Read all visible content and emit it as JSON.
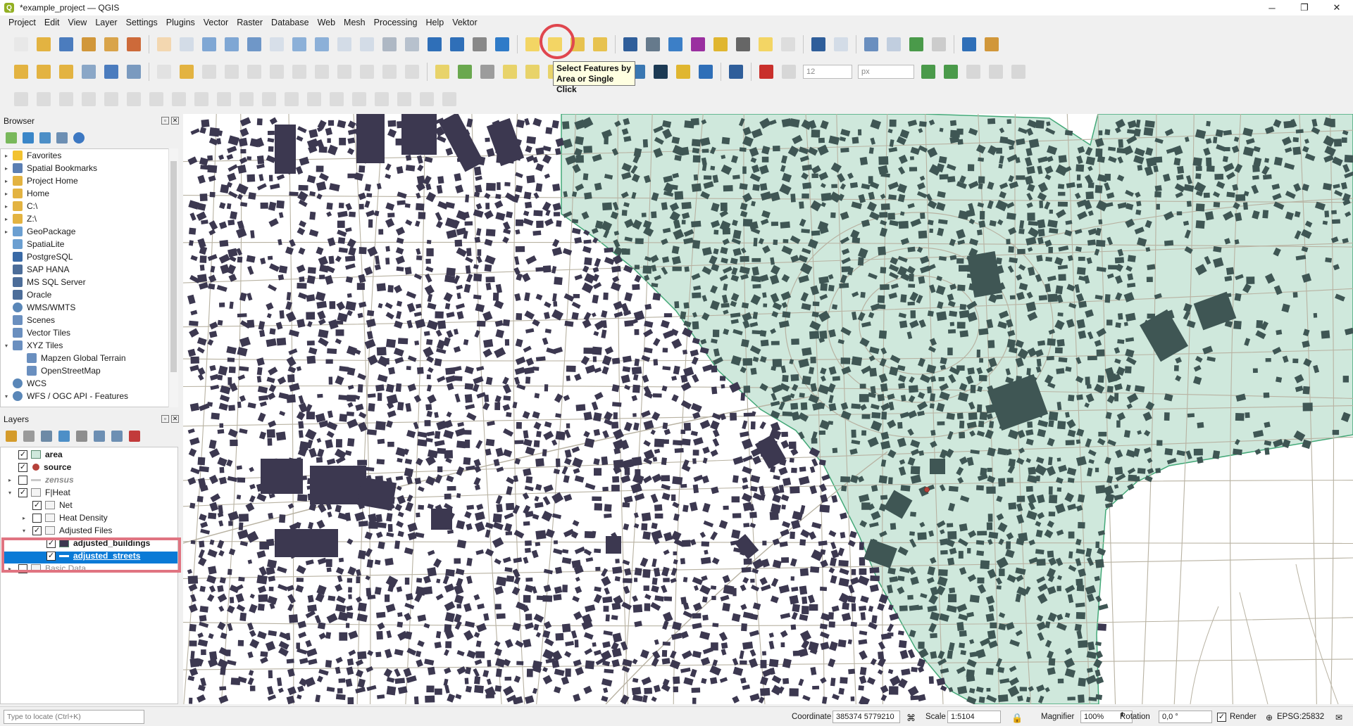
{
  "window": {
    "title": "*example_project — QGIS",
    "app_icon": "Q"
  },
  "menu": [
    "Project",
    "Edit",
    "View",
    "Layer",
    "Settings",
    "Plugins",
    "Vector",
    "Raster",
    "Database",
    "Web",
    "Mesh",
    "Processing",
    "Help",
    "Vektor"
  ],
  "toolbar": {
    "tooltip_line1": "Select Features by",
    "tooltip_line2": "Area or Single Click",
    "font_size_value": "12",
    "unit_value": "px",
    "abc_label": "abc"
  },
  "browser": {
    "title": "Browser",
    "items": [
      {
        "label": "Favorites",
        "icon": "star-icon",
        "arrow": "▸"
      },
      {
        "label": "Spatial Bookmarks",
        "icon": "bookmark-icon",
        "arrow": "▸"
      },
      {
        "label": "Project Home",
        "icon": "folder-icon",
        "arrow": "▸"
      },
      {
        "label": "Home",
        "icon": "folder-icon",
        "arrow": "▸"
      },
      {
        "label": "C:\\",
        "icon": "folder-icon",
        "arrow": "▸"
      },
      {
        "label": "Z:\\",
        "icon": "folder-icon",
        "arrow": "▸"
      },
      {
        "label": "GeoPackage",
        "icon": "geopackage-icon",
        "arrow": "▸"
      },
      {
        "label": "SpatiaLite",
        "icon": "spatialite-icon",
        "arrow": ""
      },
      {
        "label": "PostgreSQL",
        "icon": "postgresql-icon",
        "arrow": ""
      },
      {
        "label": "SAP HANA",
        "icon": "database-icon",
        "arrow": ""
      },
      {
        "label": "MS SQL Server",
        "icon": "database-icon",
        "arrow": ""
      },
      {
        "label": "Oracle",
        "icon": "database-icon",
        "arrow": ""
      },
      {
        "label": "WMS/WMTS",
        "icon": "globe-icon",
        "arrow": ""
      },
      {
        "label": "Scenes",
        "icon": "scenes-icon",
        "arrow": ""
      },
      {
        "label": "Vector Tiles",
        "icon": "grid-icon",
        "arrow": ""
      },
      {
        "label": "XYZ Tiles",
        "icon": "grid-icon",
        "arrow": "▾"
      },
      {
        "label": "Mapzen Global Terrain",
        "icon": "grid-icon",
        "arrow": "",
        "indent": true
      },
      {
        "label": "OpenStreetMap",
        "icon": "grid-icon",
        "arrow": "",
        "indent": true
      },
      {
        "label": "WCS",
        "icon": "globe-icon",
        "arrow": ""
      },
      {
        "label": "WFS / OGC API - Features",
        "icon": "globe-icon",
        "arrow": "▾"
      }
    ]
  },
  "layers": {
    "title": "Layers",
    "items": [
      {
        "label": "area",
        "checked": true,
        "bold": true,
        "symbol": "polygon-green",
        "depth": 0
      },
      {
        "label": "source",
        "checked": true,
        "bold": true,
        "symbol": "point-red",
        "depth": 0
      },
      {
        "label": "zensus",
        "checked": false,
        "bold": true,
        "italic": true,
        "symbol": "line-grey",
        "depth": 0,
        "grey": true,
        "arrow": "▸"
      },
      {
        "label": "F|Heat",
        "checked": true,
        "bold": false,
        "symbol": "group",
        "depth": 0,
        "arrow": "▾"
      },
      {
        "label": "Net",
        "checked": true,
        "bold": false,
        "symbol": "group",
        "depth": 1
      },
      {
        "label": "Heat Density",
        "checked": false,
        "bold": false,
        "symbol": "group",
        "depth": 1,
        "arrow": "▸"
      },
      {
        "label": "Adjusted Files",
        "checked": true,
        "bold": false,
        "symbol": "group",
        "depth": 1,
        "arrow": "▾"
      },
      {
        "label": "adjusted_buildings",
        "checked": true,
        "bold": true,
        "symbol": "polygon-dark",
        "depth": 2
      },
      {
        "label": "adjusted_streets",
        "checked": true,
        "bold": true,
        "symbol": "line-blue",
        "depth": 2,
        "selected": true
      },
      {
        "label": "Basic Data",
        "checked": false,
        "bold": false,
        "symbol": "group",
        "depth": 0,
        "arrow": "▸",
        "grey": true
      }
    ]
  },
  "statusbar": {
    "locator_placeholder": "Type to locate (Ctrl+K)",
    "coordinate_label": "Coordinate",
    "coordinate_value": "385374  5779210",
    "scale_label": "Scale",
    "scale_value": "1:5104",
    "magnifier_label": "Magnifier",
    "magnifier_value": "100%",
    "rotation_label": "Rotation",
    "rotation_value": "0,0 °",
    "render_label": "Render",
    "crs_label": "EPSG:25832"
  },
  "colors": {
    "building": "#3c3850",
    "street": "#b8b2a2",
    "area_fill": "#cfe8dc",
    "area_stroke": "#43a878",
    "building_in_area": "#3f5654",
    "highlight": "#e0464e",
    "selection": "#0a7ad6"
  }
}
